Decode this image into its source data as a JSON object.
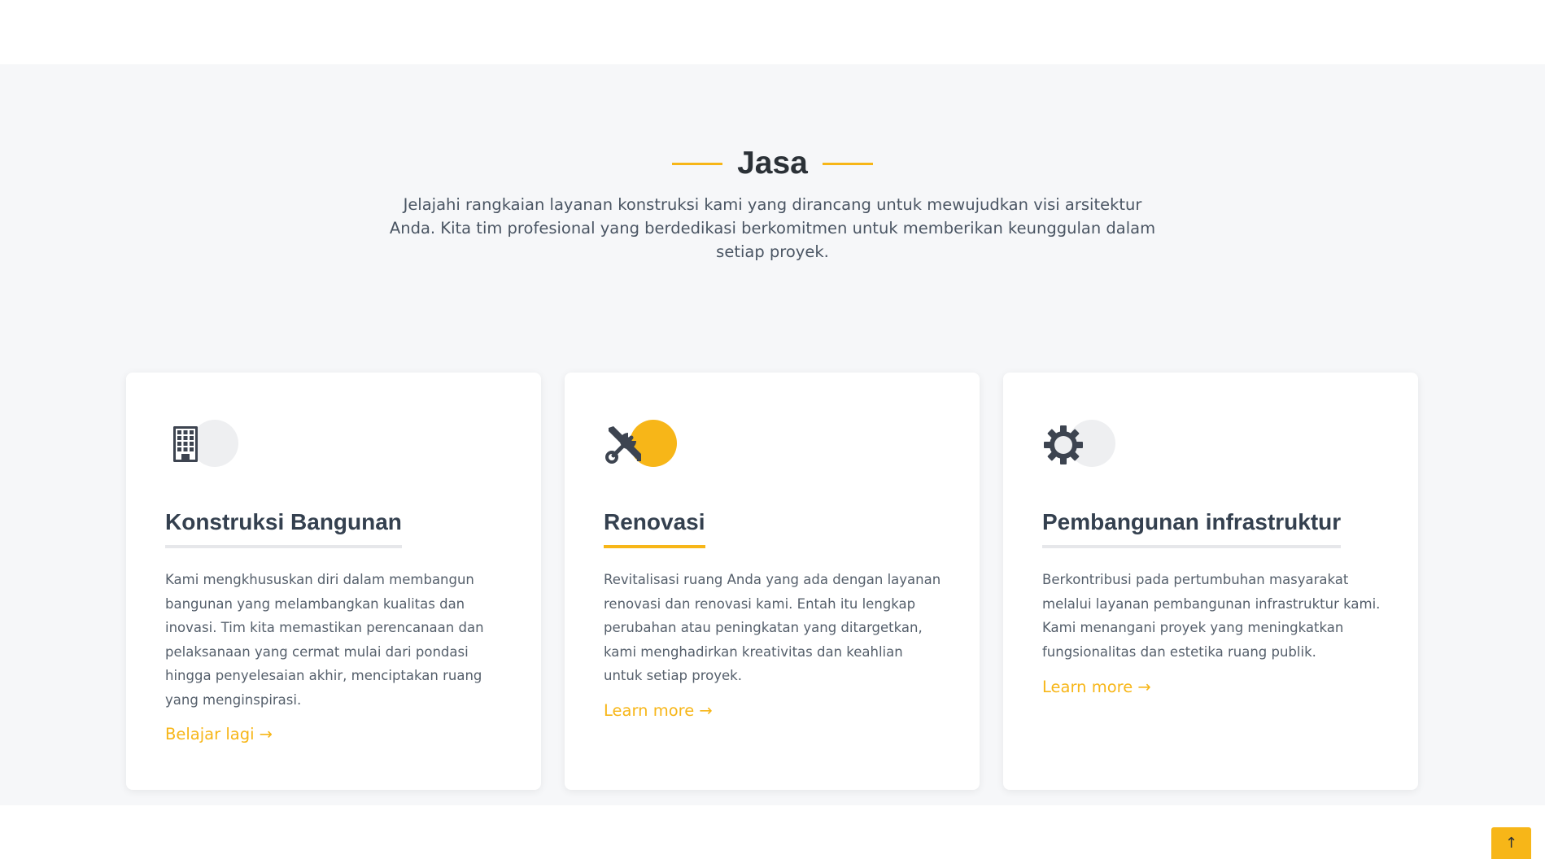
{
  "services": {
    "title": "Jasa",
    "subtitle": "Jelajahi rangkaian layanan konstruksi kami yang dirancang untuk mewujudkan visi arsitektur Anda. Kita tim profesional yang berdedikasi berkomitmen untuk memberikan keunggulan dalam setiap proyek.",
    "accent_color": "#f7b618",
    "cards": [
      {
        "icon": "building-icon",
        "title": "Konstruksi Bangunan",
        "description": "Kami mengkhususkan diri dalam membangun bangunan yang melambangkan kualitas dan inovasi. Tim kita memastikan perencanaan dan pelaksanaan yang cermat mulai dari pondasi hingga penyelesaian akhir, menciptakan ruang yang menginspirasi.",
        "link_label": "Belajar lagi",
        "link_arrow": "→"
      },
      {
        "icon": "tools-icon",
        "title": "Renovasi",
        "description": "Revitalisasi ruang Anda yang ada dengan layanan renovasi dan renovasi kami. Entah itu lengkap perubahan atau peningkatan yang ditargetkan, kami menghadirkan kreativitas dan keahlian untuk setiap proyek.",
        "link_label": "Learn more",
        "link_arrow": "→"
      },
      {
        "icon": "gear-icon",
        "title": "Pembangunan infrastruktur",
        "description": "Berkontribusi pada pertumbuhan masyarakat melalui layanan pembangunan infrastruktur kami. Kami menangani proyek yang meningkatkan fungsionalitas dan estetika ruang publik.",
        "link_label": "Learn more",
        "link_arrow": "→"
      }
    ]
  },
  "scroll_top": {
    "icon": "arrow-up-icon",
    "glyph": "↑"
  }
}
